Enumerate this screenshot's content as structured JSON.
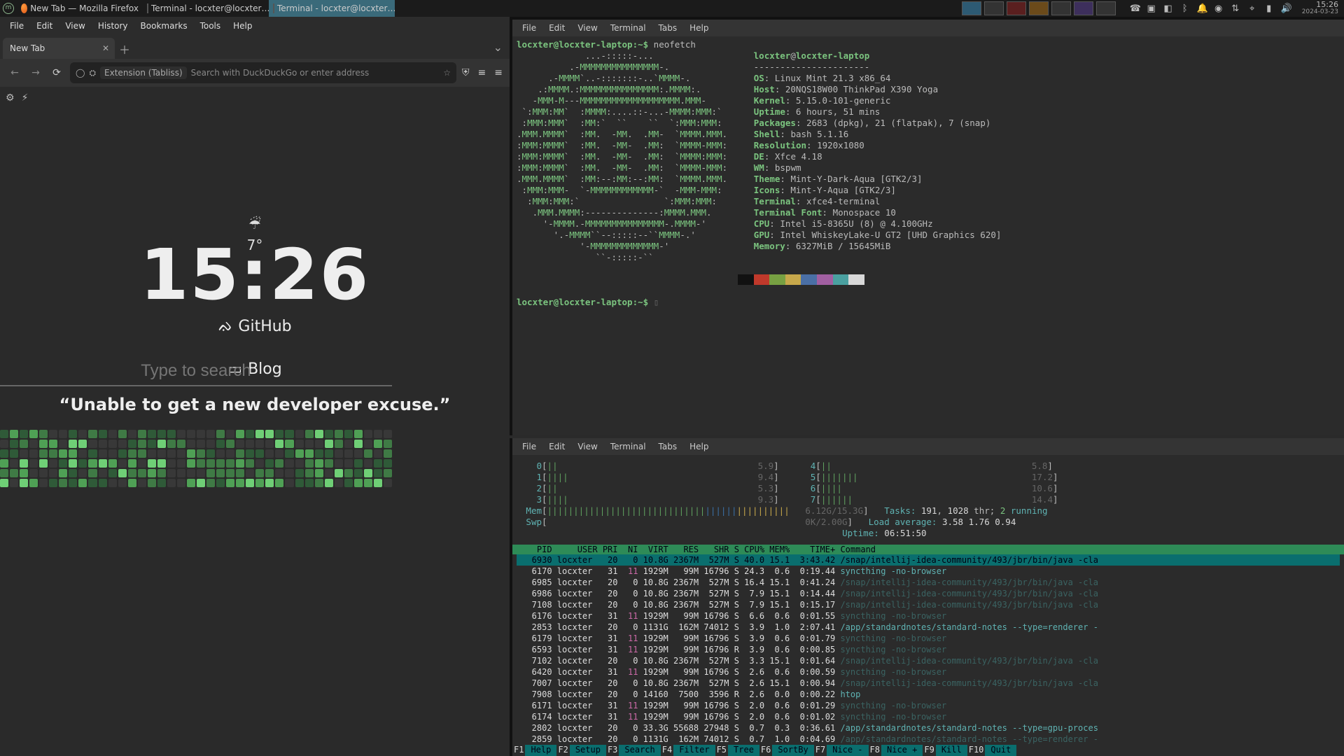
{
  "panel": {
    "tasks": [
      {
        "icon": "ff",
        "label": "New Tab — Mozilla Firefox",
        "active": false
      },
      {
        "icon": "term",
        "label": "Terminal - locxter@locxter…",
        "active": false
      },
      {
        "icon": "term",
        "label": "Terminal - locxter@locxter…",
        "active": true
      }
    ],
    "clock": "15:26",
    "date": "2024-03-23"
  },
  "firefox": {
    "menus": [
      "File",
      "Edit",
      "View",
      "History",
      "Bookmarks",
      "Tools",
      "Help"
    ],
    "tab_title": "New Tab",
    "url_chip": "Extension (Tabliss)",
    "url_placeholder": "Search with DuckDuckGo or enter address",
    "weather_temp": "7°",
    "clock": "15:26",
    "links": [
      {
        "icon": "github",
        "label": "GitHub"
      },
      {
        "icon": "book",
        "label": "Blog"
      }
    ],
    "search_placeholder": "Type to search",
    "quote": "“Unable to get a new developer excuse.”"
  },
  "term_menus": [
    "File",
    "Edit",
    "View",
    "Terminal",
    "Tabs",
    "Help"
  ],
  "neofetch": {
    "prompt": "locxter@locxter-laptop:~$",
    "cmd": "neofetch",
    "userhost": "locxter@locxter-laptop",
    "fields": [
      [
        "OS",
        "Linux Mint 21.3 x86_64"
      ],
      [
        "Host",
        "20NQS18W00 ThinkPad X390 Yoga"
      ],
      [
        "Kernel",
        "5.15.0-101-generic"
      ],
      [
        "Uptime",
        "6 hours, 51 mins"
      ],
      [
        "Packages",
        "2683 (dpkg), 21 (flatpak), 7 (snap)"
      ],
      [
        "Shell",
        "bash 5.1.16"
      ],
      [
        "Resolution",
        "1920x1080"
      ],
      [
        "DE",
        "Xfce 4.18"
      ],
      [
        "WM",
        "bspwm"
      ],
      [
        "Theme",
        "Mint-Y-Dark-Aqua [GTK2/3]"
      ],
      [
        "Icons",
        "Mint-Y-Aqua [GTK2/3]"
      ],
      [
        "Terminal",
        "xfce4-terminal"
      ],
      [
        "Terminal Font",
        "Monospace 10"
      ],
      [
        "CPU",
        "Intel i5-8365U (8) @ 4.100GHz"
      ],
      [
        "GPU",
        "Intel WhiskeyLake-U GT2 [UHD Graphics 620]"
      ],
      [
        "Memory",
        "6327MiB / 15645MiB"
      ]
    ]
  },
  "htop": {
    "cpu_pct": [
      "5.9%",
      "9.4%",
      "5.3%",
      "9.3%",
      "5.8%",
      "17.2%",
      "10.6%",
      "14.4%"
    ],
    "mem_used": "6.12G",
    "mem_total": "15.3G",
    "swp_used": "0K",
    "swp_total": "2.00G",
    "tasks": "191",
    "threads": "1028",
    "running": "2",
    "load": "3.58 1.76 0.94",
    "uptime": "06:51:50",
    "cols": [
      "PID",
      "USER",
      "PRI",
      "NI",
      "VIRT",
      "RES",
      "SHR",
      "S",
      "CPU%",
      "MEM%",
      "TIME+",
      "Command"
    ],
    "rows": [
      {
        "sel": true,
        "pid": "6930",
        "user": "locxter",
        "pri": "20",
        "ni": "0",
        "virt": "10.8G",
        "res": "2367M",
        "shr": "527M",
        "s": "S",
        "cpu": "40.0",
        "mem": "15.1",
        "time": "3:43.42",
        "cmd": "/snap/intellij-idea-community/493/jbr/bin/java -cla",
        "dim": false
      },
      {
        "pid": "6170",
        "user": "locxter",
        "pri": "31",
        "ni": "11",
        "virt": "1929M",
        "res": "99M",
        "shr": "16796",
        "s": "S",
        "cpu": "24.3",
        "mem": "0.6",
        "time": "0:19.44",
        "cmd": "syncthing -no-browser",
        "dim": false
      },
      {
        "pid": "6985",
        "user": "locxter",
        "pri": "20",
        "ni": "0",
        "virt": "10.8G",
        "res": "2367M",
        "shr": "527M",
        "s": "S",
        "cpu": "16.4",
        "mem": "15.1",
        "time": "0:41.24",
        "cmd": "/snap/intellij-idea-community/493/jbr/bin/java -cla",
        "dim": true
      },
      {
        "pid": "6986",
        "user": "locxter",
        "pri": "20",
        "ni": "0",
        "virt": "10.8G",
        "res": "2367M",
        "shr": "527M",
        "s": "S",
        "cpu": "7.9",
        "mem": "15.1",
        "time": "0:14.44",
        "cmd": "/snap/intellij-idea-community/493/jbr/bin/java -cla",
        "dim": true
      },
      {
        "pid": "7108",
        "user": "locxter",
        "pri": "20",
        "ni": "0",
        "virt": "10.8G",
        "res": "2367M",
        "shr": "527M",
        "s": "S",
        "cpu": "7.9",
        "mem": "15.1",
        "time": "0:15.17",
        "cmd": "/snap/intellij-idea-community/493/jbr/bin/java -cla",
        "dim": true
      },
      {
        "pid": "6176",
        "user": "locxter",
        "pri": "31",
        "ni": "11",
        "virt": "1929M",
        "res": "99M",
        "shr": "16796",
        "s": "S",
        "cpu": "6.6",
        "mem": "0.6",
        "time": "0:01.55",
        "cmd": "syncthing -no-browser",
        "dim": true
      },
      {
        "pid": "2853",
        "user": "locxter",
        "pri": "20",
        "ni": "0",
        "virt": "1131G",
        "res": "162M",
        "shr": "74012",
        "s": "S",
        "cpu": "3.9",
        "mem": "1.0",
        "time": "2:07.41",
        "cmd": "/app/standardnotes/standard-notes --type=renderer -",
        "dim": false
      },
      {
        "pid": "6179",
        "user": "locxter",
        "pri": "31",
        "ni": "11",
        "virt": "1929M",
        "res": "99M",
        "shr": "16796",
        "s": "S",
        "cpu": "3.9",
        "mem": "0.6",
        "time": "0:01.79",
        "cmd": "syncthing -no-browser",
        "dim": true
      },
      {
        "pid": "6593",
        "user": "locxter",
        "pri": "31",
        "ni": "11",
        "virt": "1929M",
        "res": "99M",
        "shr": "16796",
        "s": "R",
        "cpu": "3.9",
        "mem": "0.6",
        "time": "0:00.85",
        "cmd": "syncthing -no-browser",
        "dim": true
      },
      {
        "pid": "7102",
        "user": "locxter",
        "pri": "20",
        "ni": "0",
        "virt": "10.8G",
        "res": "2367M",
        "shr": "527M",
        "s": "S",
        "cpu": "3.3",
        "mem": "15.1",
        "time": "0:01.64",
        "cmd": "/snap/intellij-idea-community/493/jbr/bin/java -cla",
        "dim": true
      },
      {
        "pid": "6420",
        "user": "locxter",
        "pri": "31",
        "ni": "11",
        "virt": "1929M",
        "res": "99M",
        "shr": "16796",
        "s": "S",
        "cpu": "2.6",
        "mem": "0.6",
        "time": "0:00.59",
        "cmd": "syncthing -no-browser",
        "dim": true
      },
      {
        "pid": "7007",
        "user": "locxter",
        "pri": "20",
        "ni": "0",
        "virt": "10.8G",
        "res": "2367M",
        "shr": "527M",
        "s": "S",
        "cpu": "2.6",
        "mem": "15.1",
        "time": "0:00.94",
        "cmd": "/snap/intellij-idea-community/493/jbr/bin/java -cla",
        "dim": true
      },
      {
        "pid": "7908",
        "user": "locxter",
        "pri": "20",
        "ni": "0",
        "virt": "14160",
        "res": "7500",
        "shr": "3596",
        "s": "R",
        "cpu": "2.6",
        "mem": "0.0",
        "time": "0:00.22",
        "cmd": "htop",
        "dim": false
      },
      {
        "pid": "6171",
        "user": "locxter",
        "pri": "31",
        "ni": "11",
        "virt": "1929M",
        "res": "99M",
        "shr": "16796",
        "s": "S",
        "cpu": "2.0",
        "mem": "0.6",
        "time": "0:01.29",
        "cmd": "syncthing -no-browser",
        "dim": true
      },
      {
        "pid": "6174",
        "user": "locxter",
        "pri": "31",
        "ni": "11",
        "virt": "1929M",
        "res": "99M",
        "shr": "16796",
        "s": "S",
        "cpu": "2.0",
        "mem": "0.6",
        "time": "0:01.02",
        "cmd": "syncthing -no-browser",
        "dim": true
      },
      {
        "pid": "2802",
        "user": "locxter",
        "pri": "20",
        "ni": "0",
        "virt": "33.3G",
        "res": "55688",
        "shr": "27948",
        "s": "S",
        "cpu": "0.7",
        "mem": "0.3",
        "time": "0:36.61",
        "cmd": "/app/standardnotes/standard-notes --type=gpu-proces",
        "dim": false
      },
      {
        "pid": "2859",
        "user": "locxter",
        "pri": "20",
        "ni": "0",
        "virt": "1131G",
        "res": "162M",
        "shr": "74012",
        "s": "S",
        "cpu": "0.7",
        "mem": "1.0",
        "time": "0:04.69",
        "cmd": "/app/standardnotes/standard-notes --type=renderer -",
        "dim": true
      }
    ],
    "fkeys": [
      [
        "F1",
        "Help"
      ],
      [
        "F2",
        "Setup"
      ],
      [
        "F3",
        "Search"
      ],
      [
        "F4",
        "Filter"
      ],
      [
        "F5",
        "Tree"
      ],
      [
        "F6",
        "SortBy"
      ],
      [
        "F7",
        "Nice -"
      ],
      [
        "F8",
        "Nice +"
      ],
      [
        "F9",
        "Kill"
      ],
      [
        "F10",
        "Quit"
      ]
    ]
  },
  "grid_seed": 20240323
}
